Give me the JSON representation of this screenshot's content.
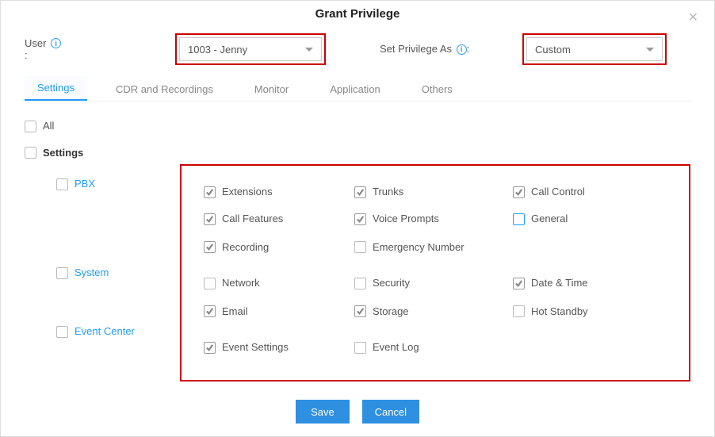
{
  "title": "Grant Privilege",
  "user": {
    "label": "User",
    "value": "1003 - Jenny"
  },
  "privilege": {
    "label": "Set Privilege As",
    "value": "Custom"
  },
  "tabs": {
    "settings": "Settings",
    "cdr": "CDR and Recordings",
    "monitor": "Monitor",
    "application": "Application",
    "others": "Others"
  },
  "all_label": "All",
  "section_label": "Settings",
  "groups": {
    "pbx": {
      "label": "PBX",
      "items": {
        "extensions": {
          "label": "Extensions",
          "checked": true
        },
        "trunks": {
          "label": "Trunks",
          "checked": true
        },
        "call_control": {
          "label": "Call Control",
          "checked": true
        },
        "call_features": {
          "label": "Call Features",
          "checked": true
        },
        "voice_prompts": {
          "label": "Voice Prompts",
          "checked": true
        },
        "general": {
          "label": "General",
          "checked": false,
          "outline": "blue"
        },
        "recording": {
          "label": "Recording",
          "checked": true
        },
        "emergency_number": {
          "label": "Emergency Number",
          "checked": false
        }
      }
    },
    "system": {
      "label": "System",
      "items": {
        "network": {
          "label": "Network",
          "checked": false
        },
        "security": {
          "label": "Security",
          "checked": false
        },
        "date_time": {
          "label": "Date & Time",
          "checked": true
        },
        "email": {
          "label": "Email",
          "checked": true
        },
        "storage": {
          "label": "Storage",
          "checked": true
        },
        "hot_standby": {
          "label": "Hot Standby",
          "checked": false
        }
      }
    },
    "event_center": {
      "label": "Event Center",
      "items": {
        "event_settings": {
          "label": "Event Settings",
          "checked": true
        },
        "event_log": {
          "label": "Event Log",
          "checked": false
        }
      }
    }
  },
  "buttons": {
    "save": "Save",
    "cancel": "Cancel"
  }
}
